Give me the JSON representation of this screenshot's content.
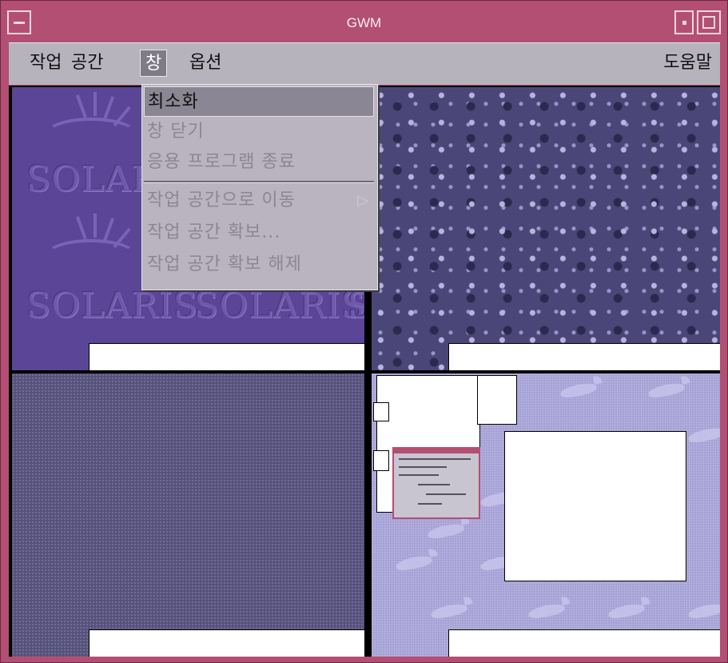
{
  "window": {
    "title": "GWM"
  },
  "menubar": {
    "items": [
      "작업",
      "공간",
      "창",
      "옵션"
    ],
    "active": "창",
    "help": "도움말"
  },
  "dropdown": {
    "items": [
      {
        "label": "최소화",
        "enabled": true,
        "highlighted": true
      },
      {
        "label": "창 닫기",
        "enabled": false
      },
      {
        "label": "응용 프로그램 종료",
        "enabled": false
      },
      {
        "label": "작업 공간으로 이동",
        "enabled": false,
        "submenu": true
      },
      {
        "label": "작업 공간 확보...",
        "enabled": false
      },
      {
        "label": "작업 공간 확보 해제",
        "enabled": false
      }
    ],
    "submenu_glyph": "▷"
  },
  "workspaces": {
    "logo_text": "SOLARIS",
    "logo_repeat": [
      "SOLARIS",
      "SOLARIS",
      "SOLARIS",
      "SOLARIS"
    ]
  },
  "colors": {
    "frame": "#b34f72",
    "menubar": "#b7b3bd",
    "menu_active": "#7f7b87"
  }
}
